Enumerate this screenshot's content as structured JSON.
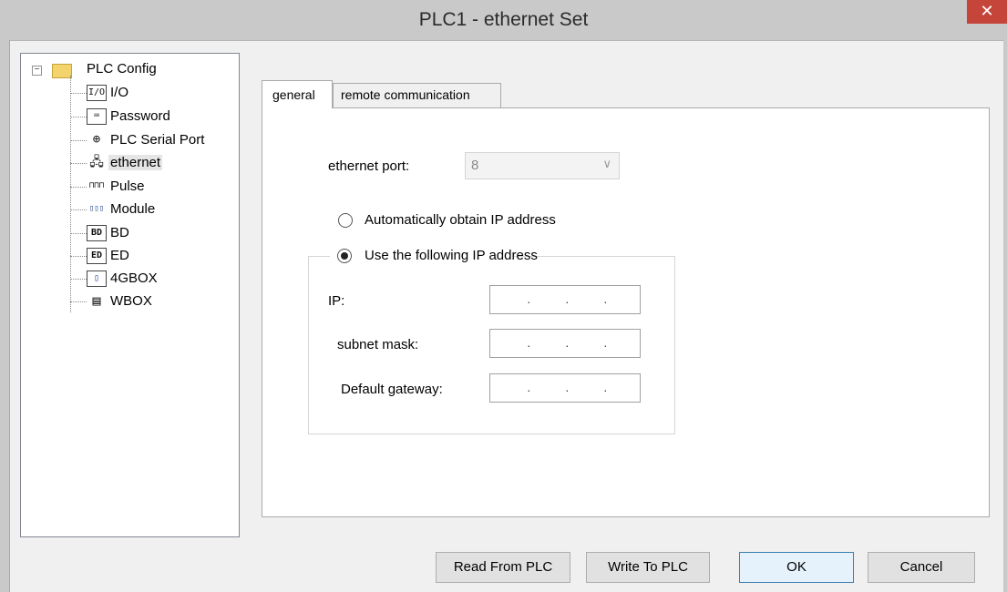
{
  "window": {
    "title": "PLC1 - ethernet  Set",
    "close_glyph": "✕"
  },
  "tree": {
    "root": "PLC Config",
    "expander": "−",
    "items": [
      {
        "label": "I/O",
        "icon": "io-icon",
        "glyph": "I/O"
      },
      {
        "label": "Password",
        "icon": "password-icon",
        "glyph": "⌨"
      },
      {
        "label": "PLC Serial Port",
        "icon": "serial-port-icon",
        "glyph": "⊕"
      },
      {
        "label": "ethernet",
        "icon": "ethernet-icon",
        "glyph": "🖧",
        "selected": true
      },
      {
        "label": "Pulse",
        "icon": "pulse-icon",
        "glyph": "⊓⊓⊓"
      },
      {
        "label": "Module",
        "icon": "module-icon",
        "glyph": "▯▯▯"
      },
      {
        "label": "BD",
        "icon": "bd-icon",
        "glyph": "BD"
      },
      {
        "label": "ED",
        "icon": "ed-icon",
        "glyph": "ED"
      },
      {
        "label": "4GBOX",
        "icon": "4gbox-icon",
        "glyph": "▯"
      },
      {
        "label": "WBOX",
        "icon": "wbox-icon",
        "glyph": "▤"
      }
    ]
  },
  "tabs": {
    "general": "general",
    "remote": "remote communication"
  },
  "general": {
    "ethernet_port_label": "ethernet port:",
    "ethernet_port_value": "8",
    "combo_arrow": "∨",
    "radio_auto": "Automatically obtain IP address",
    "radio_manual": "Use the following IP address",
    "selected_mode": "manual",
    "ip_label": "IP:",
    "subnet_label": "subnet mask:",
    "gateway_label": "Default gateway:",
    "ip_dot": "·"
  },
  "buttons": {
    "read": "Read From PLC",
    "write": "Write To PLC",
    "ok": "OK",
    "cancel": "Cancel"
  }
}
